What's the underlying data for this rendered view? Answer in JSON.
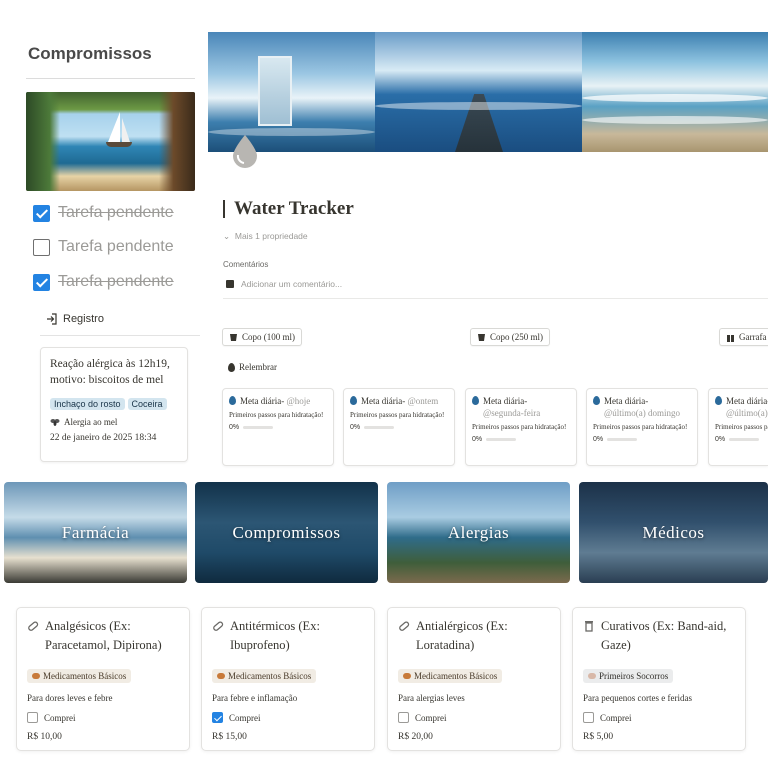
{
  "sidebar": {
    "title": "Compromissos",
    "image": "beach-window-image",
    "tasks": [
      {
        "label": "Tarefa pendente",
        "checked": true
      },
      {
        "label": "Tarefa pendente",
        "checked": false
      },
      {
        "label": "Tarefa pendente",
        "checked": true
      }
    ],
    "registro_label": "Registro",
    "registro_card": {
      "text": "Reação alérgica às 12h19, motivo: biscoitos de mel",
      "tags": [
        "Inchaço do rosto",
        "Coceira"
      ],
      "relation": "Alergia ao mel",
      "datetime": "22 de janeiro de 2025 18:34"
    }
  },
  "page": {
    "icon": "water-drop-icon",
    "title": "Water Tracker",
    "more_props": "Mais 1 propriedade",
    "comments_label": "Comentários",
    "comment_placeholder": "Adicionar um comentário..."
  },
  "buttons": [
    {
      "label": "Copo (100 ml)"
    },
    {
      "label": "Copo (250 ml)"
    },
    {
      "label": "Garrafa"
    }
  ],
  "remind_label": "Relembrar",
  "goals": [
    {
      "title": "Meta diária-",
      "mention": "@hoje",
      "desc": "Primeiros passos para hidratação!",
      "progress": "0%"
    },
    {
      "title": "Meta diária-",
      "mention": "@ontem",
      "desc": "Primeiros passos para hidratação!",
      "progress": "0%"
    },
    {
      "title": "Meta diária-",
      "mention": "@segunda-feira",
      "desc": "Primeiros passos para hidratação!",
      "progress": "0%"
    },
    {
      "title": "Meta diária-",
      "mention": "@último(a) domingo",
      "desc": "Primeiros passos para hidratação!",
      "progress": "0%"
    },
    {
      "title": "Meta diária-",
      "mention": "@último(a)",
      "desc": "Primeiros passos para hidratação!",
      "progress": "0%"
    }
  ],
  "categories": [
    {
      "label": "Farmácia"
    },
    {
      "label": "Compromissos"
    },
    {
      "label": "Alergias"
    },
    {
      "label": "Médicos"
    }
  ],
  "products": [
    {
      "name": "Analgésicos (Ex: Paracetamol, Dipirona)",
      "tag": "Medicamentos Básicos",
      "desc": "Para dores leves e febre",
      "check_label": "Comprei",
      "checked": false,
      "price": "R$ 10,00"
    },
    {
      "name": "Antitérmicos (Ex: Ibuprofeno)",
      "tag": "Medicamentos Básicos",
      "desc": "Para febre e inflamação",
      "check_label": "Comprei",
      "checked": true,
      "price": "R$ 15,00"
    },
    {
      "name": "Antialérgicos (Ex: Loratadina)",
      "tag": "Medicamentos Básicos",
      "desc": "Para alergias leves",
      "check_label": "Comprei",
      "checked": false,
      "price": "R$ 20,00"
    },
    {
      "name": "Curativos (Ex: Band-aid, Gaze)",
      "tag": "Primeiros Socorros",
      "desc": "Para pequenos cortes e feridas",
      "check_label": "Comprei",
      "checked": false,
      "price": "R$ 5,00"
    }
  ],
  "colors": {
    "accent": "#2383e2",
    "tag_blue": "#d3e5ef",
    "tag_beige": "#f1ece4",
    "tag_gray": "#ebeced"
  }
}
